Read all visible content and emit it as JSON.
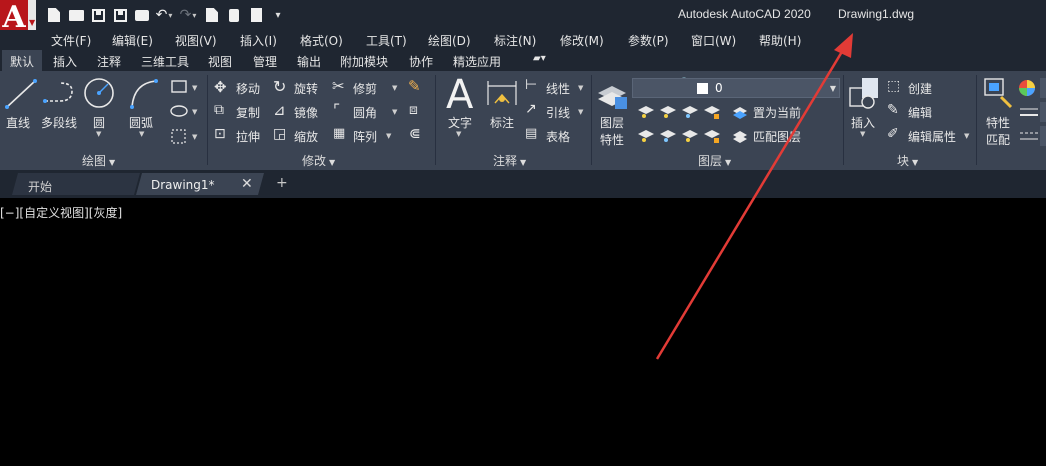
{
  "titlebar": {
    "app_title": "Autodesk AutoCAD 2020",
    "doc_title": "Drawing1.dwg",
    "quick_access": [
      "new-icon",
      "open-icon",
      "save-icon",
      "save-as-icon",
      "print-icon",
      "undo-icon",
      "redo-icon",
      "publish-icon",
      "plot-icon",
      "calculator-icon",
      "customize-icon"
    ]
  },
  "menu": {
    "items": [
      "文件(F)",
      "编辑(E)",
      "视图(V)",
      "插入(I)",
      "格式(O)",
      "工具(T)",
      "绘图(D)",
      "标注(N)",
      "修改(M)",
      "参数(P)",
      "窗口(W)",
      "帮助(H)"
    ]
  },
  "ribbon_tabs": {
    "items": [
      "默认",
      "插入",
      "注释",
      "三维工具",
      "视图",
      "管理",
      "输出",
      "附加模块",
      "协作",
      "精选应用"
    ],
    "active": "默认"
  },
  "draw_panel": {
    "title": "绘图",
    "tools": [
      "直线",
      "多段线",
      "圆",
      "圆弧"
    ]
  },
  "modify_panel": {
    "title": "修改",
    "tools": [
      "移动",
      "旋转",
      "修剪",
      "复制",
      "镜像",
      "圆角",
      "拉伸",
      "缩放",
      "阵列"
    ]
  },
  "annotation_panel": {
    "title": "注释",
    "tools": [
      "文字",
      "标注",
      "线性",
      "引线",
      "表格"
    ]
  },
  "layers_panel": {
    "title": "图层",
    "props_label_1": "图层",
    "props_label_2": "特性",
    "current_layer": "0",
    "tools": [
      "置为当前",
      "匹配图层"
    ]
  },
  "block_panel": {
    "title": "块",
    "insert_label": "插入",
    "tools": [
      "创建",
      "编辑",
      "编辑属性"
    ]
  },
  "properties_panel": {
    "match_label_1": "特性",
    "match_label_2": "匹配"
  },
  "doc_tabs": {
    "start": "开始",
    "drawing": "Drawing1*"
  },
  "canvas": {
    "viewport_label": "[−][自定义视图][灰度]"
  },
  "colors": {
    "titlebar_bg": "#1f2631",
    "ribbon_bg": "#3b4453",
    "accent_red": "#e23b36",
    "canvas_bg": "#000000"
  }
}
